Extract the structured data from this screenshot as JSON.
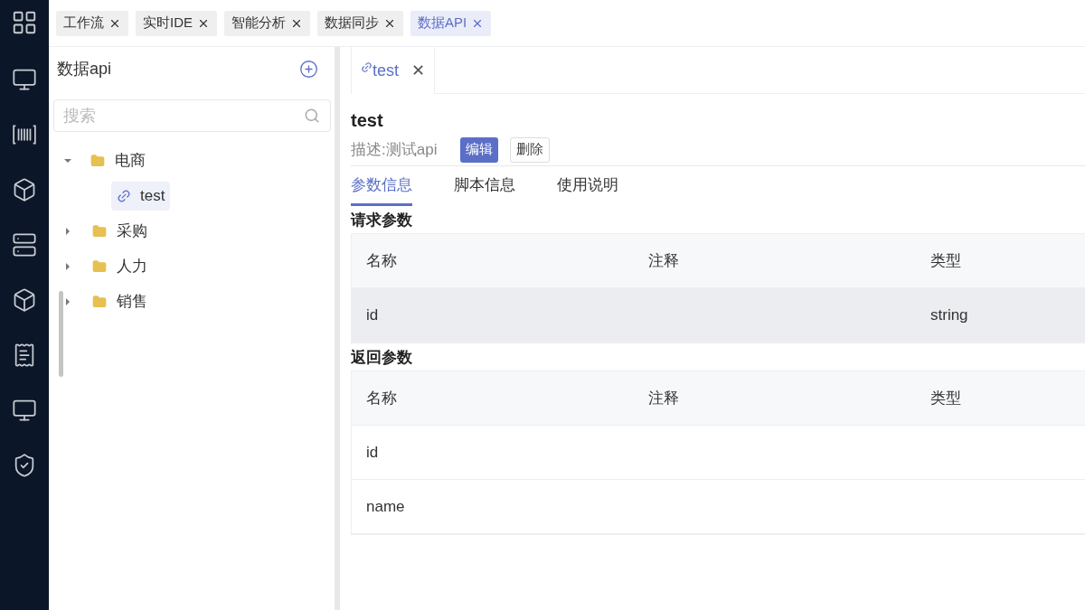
{
  "top_tabs": [
    {
      "label": "工作流",
      "selected": false
    },
    {
      "label": "实时IDE",
      "selected": false
    },
    {
      "label": "智能分析",
      "selected": false
    },
    {
      "label": "数据同步",
      "selected": false
    },
    {
      "label": "数据API",
      "selected": true
    }
  ],
  "side_panel": {
    "title": "数据api",
    "search": {
      "placeholder": "搜索"
    },
    "tree": [
      {
        "kind": "folder",
        "label": "电商",
        "expanded": true,
        "children": [
          {
            "kind": "api",
            "label": "test",
            "selected": true
          }
        ]
      },
      {
        "kind": "folder",
        "label": "采购",
        "expanded": false
      },
      {
        "kind": "folder",
        "label": "人力",
        "expanded": false
      },
      {
        "kind": "folder",
        "label": "销售",
        "expanded": false
      }
    ]
  },
  "doc_tab": {
    "label": "test",
    "close": "✕"
  },
  "detail": {
    "name": "test",
    "description": "描述:测试api",
    "buttons": [
      {
        "label": "编辑",
        "kind": "primary"
      },
      {
        "label": "删除",
        "kind": "default"
      }
    ],
    "tabs": [
      {
        "label": "参数信息",
        "selected": true
      },
      {
        "label": "脚本信息",
        "selected": false
      },
      {
        "label": "使用说明",
        "selected": false
      }
    ],
    "sections": [
      {
        "title": "请求参数",
        "columns": [
          "名称",
          "注释",
          "类型"
        ],
        "rows": [
          {
            "cells": [
              "id",
              "",
              "string"
            ],
            "highlighted": true
          }
        ]
      },
      {
        "title": "返回参数",
        "columns": [
          "名称",
          "注释",
          "类型"
        ],
        "rows": [
          {
            "cells": [
              "id",
              "",
              ""
            ],
            "highlighted": false
          },
          {
            "cells": [
              "name",
              "",
              ""
            ],
            "highlighted": false
          }
        ]
      }
    ]
  }
}
